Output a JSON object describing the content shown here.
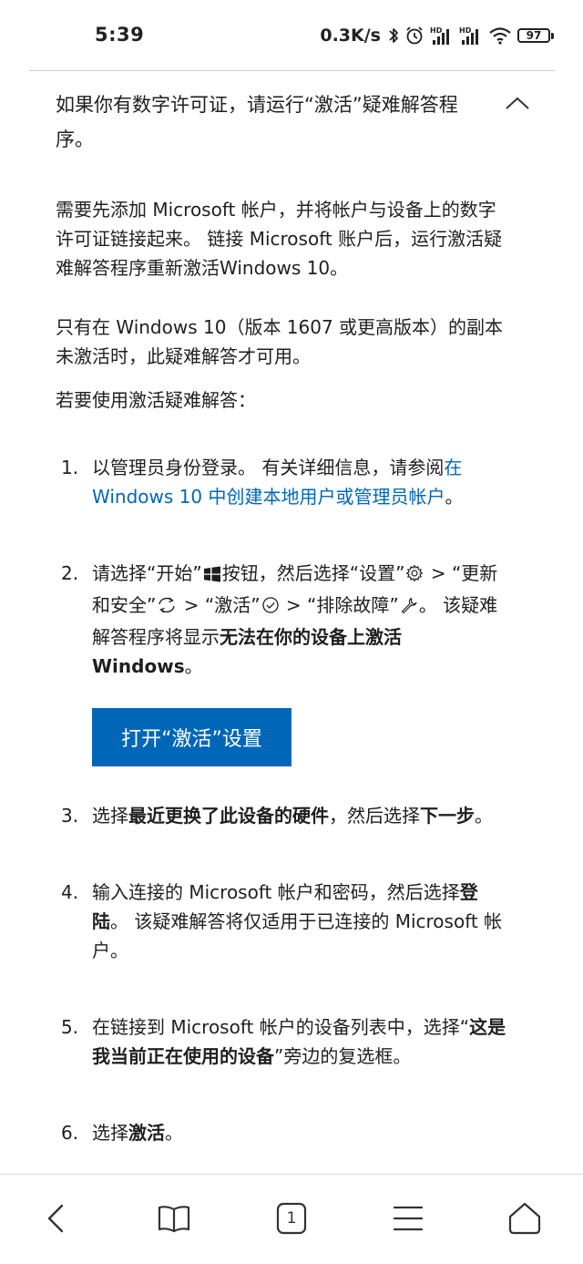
{
  "status_bar": {
    "time": "5:39",
    "net_speed": "0.3K/s",
    "battery_level": "97",
    "icons": [
      "bluetooth-icon",
      "alarm-icon",
      "signal-hd-icon",
      "signal-hd-icon",
      "wifi-icon",
      "battery-icon"
    ]
  },
  "article": {
    "accordion_title": "如果你有数字许可证，请运行“激活”疑难解答程序。",
    "paragraphs": [
      "需要先添加 Microsoft 帐户，并将帐户与设备上的数字许可证链接起来。 链接 Microsoft 账户后，运行激活疑难解答程序重新激活Windows 10。",
      "只有在 Windows 10（版本 1607 或更高版本）的副本未激活时，此疑难解答才可用。",
      "若要使用激活疑难解答："
    ],
    "steps": [
      {
        "num": "1.",
        "text_before_link": "以管理员身份登录。 有关详细信息，请参阅",
        "link": "在 Windows 10 中创建本地用户或管理员帐户",
        "text_after_link": "。"
      },
      {
        "num": "2.",
        "t1": "请选择“开始”",
        "t2": "按钮，然后选择“设置”",
        "t3": " > “更新和安全”",
        "t4": " > “激活”",
        "t5": " > “排除故障”",
        "t6": "。 该疑难解答程序将显示",
        "bold": "无法在你的设备上激活 Windows",
        "t7": "。"
      },
      {
        "num": "3.",
        "t1": "选择",
        "bold1": "最近更换了此设备的硬件",
        "t2": "，然后选择",
        "bold2": "下一步",
        "t3": "。"
      },
      {
        "num": "4.",
        "t1": "输入连接的 Microsoft 帐户和密码，然后选择",
        "bold": "登陆",
        "t2": "。 该疑难解答将仅适用于已连接的 Microsoft 帐户。"
      },
      {
        "num": "5.",
        "t1": "在链接到 Microsoft 帐户的设备列表中，选择“",
        "bold": "这是我当前正在使用的设备",
        "t2": "”旁边的复选框。"
      },
      {
        "num": "6.",
        "t1": "选择",
        "bold": "激活",
        "t2": "。"
      }
    ],
    "cta_label": "打开“激活”设置"
  },
  "bottom_nav": {
    "tab_count": "1",
    "icons": [
      "back-icon",
      "bookmarks-icon",
      "tabs-icon",
      "menu-icon",
      "home-icon"
    ]
  },
  "colors": {
    "accent": "#0067b8",
    "text": "#1f1f1f",
    "background": "#ffffff"
  }
}
